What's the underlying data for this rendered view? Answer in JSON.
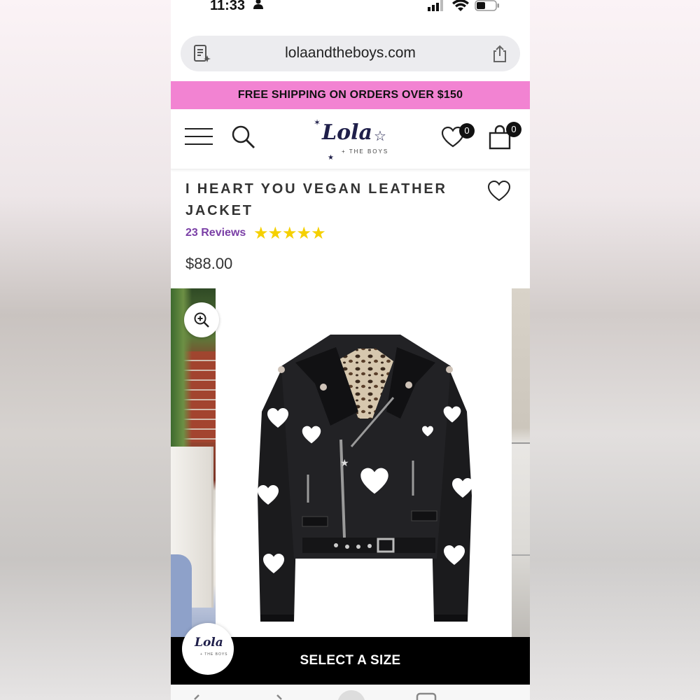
{
  "status_bar": {
    "time": "11:33"
  },
  "browser": {
    "url": "lolaandtheboys.com"
  },
  "promo": {
    "text": "FREE SHIPPING ON ORDERS OVER $150"
  },
  "header": {
    "logo_script": "Lola",
    "logo_tag": "+ THE BOYS",
    "wishlist_count": "0",
    "cart_count": "0"
  },
  "product": {
    "title": "I HEART YOU VEGAN LEATHER JACKET",
    "reviews_label": "23 Reviews",
    "rating_stars": 5,
    "stars_text": "★★★★★",
    "price": "$88.00"
  },
  "chat": {
    "mini_script": "Lola",
    "mini_tag": "+ THE BOYS"
  },
  "cta": {
    "label": "SELECT A SIZE"
  },
  "colors": {
    "promo_bg": "#f283d2",
    "reviews_purple": "#7a3fa6",
    "star_yellow": "#f5d000",
    "cta_bg": "#000000"
  },
  "icons": [
    "person-icon",
    "signal-icon",
    "wifi-icon",
    "battery-icon",
    "reader-icon",
    "share-icon",
    "menu-icon",
    "search-icon",
    "heart-icon",
    "bag-icon",
    "zoom-in-icon"
  ]
}
